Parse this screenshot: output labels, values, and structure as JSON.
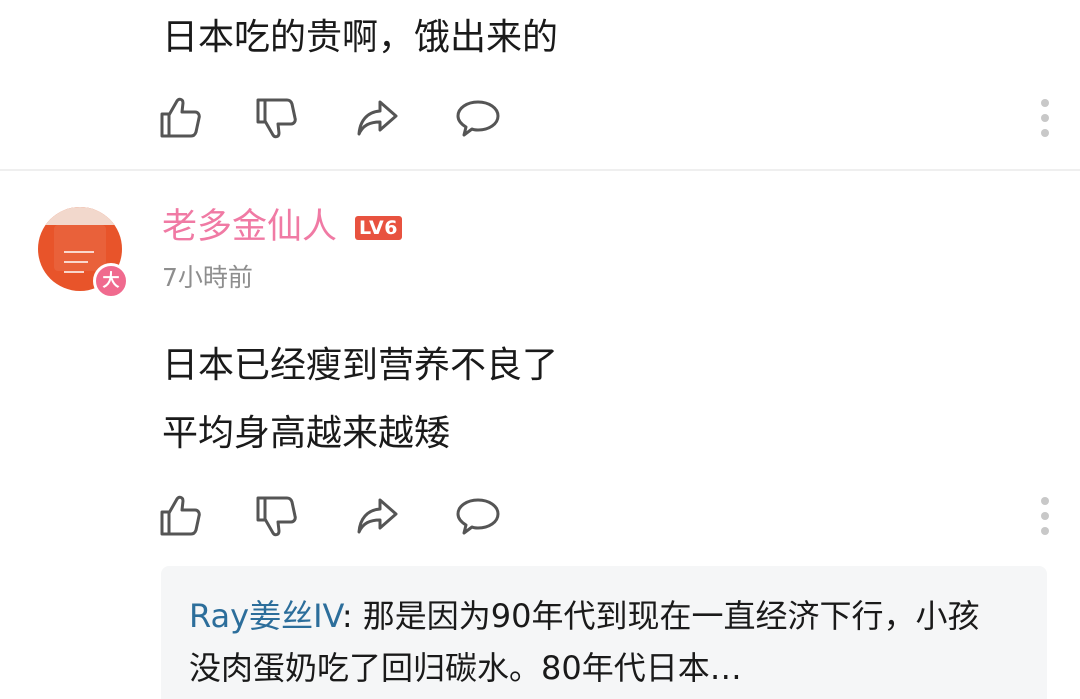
{
  "comment_1": {
    "text": "日本吃的贵啊，饿出来的"
  },
  "comment_2": {
    "username": "老多金仙人",
    "level": "LV6",
    "badge": "大",
    "timestamp": "7小時前",
    "lines": [
      "日本已经瘦到营养不良了",
      "平均身高越来越矮"
    ],
    "reply": {
      "user": "Ray姜丝IV",
      "separator": ": ",
      "text": "那是因为90年代到现在一直经济下行，小孩没肉蛋奶吃了回归碳水。80年代日本…"
    }
  },
  "icons": {
    "like": "thumbs-up-icon",
    "dislike": "thumbs-down-icon",
    "share": "share-arrow-icon",
    "comment": "comment-bubble-icon",
    "more": "more-vertical-icon"
  },
  "colors": {
    "username": "#f07aa4",
    "level_badge": "#e8523f",
    "reply_user": "#2c6e9b",
    "timestamp": "#8e8e8e",
    "icon_stroke": "#555555"
  }
}
